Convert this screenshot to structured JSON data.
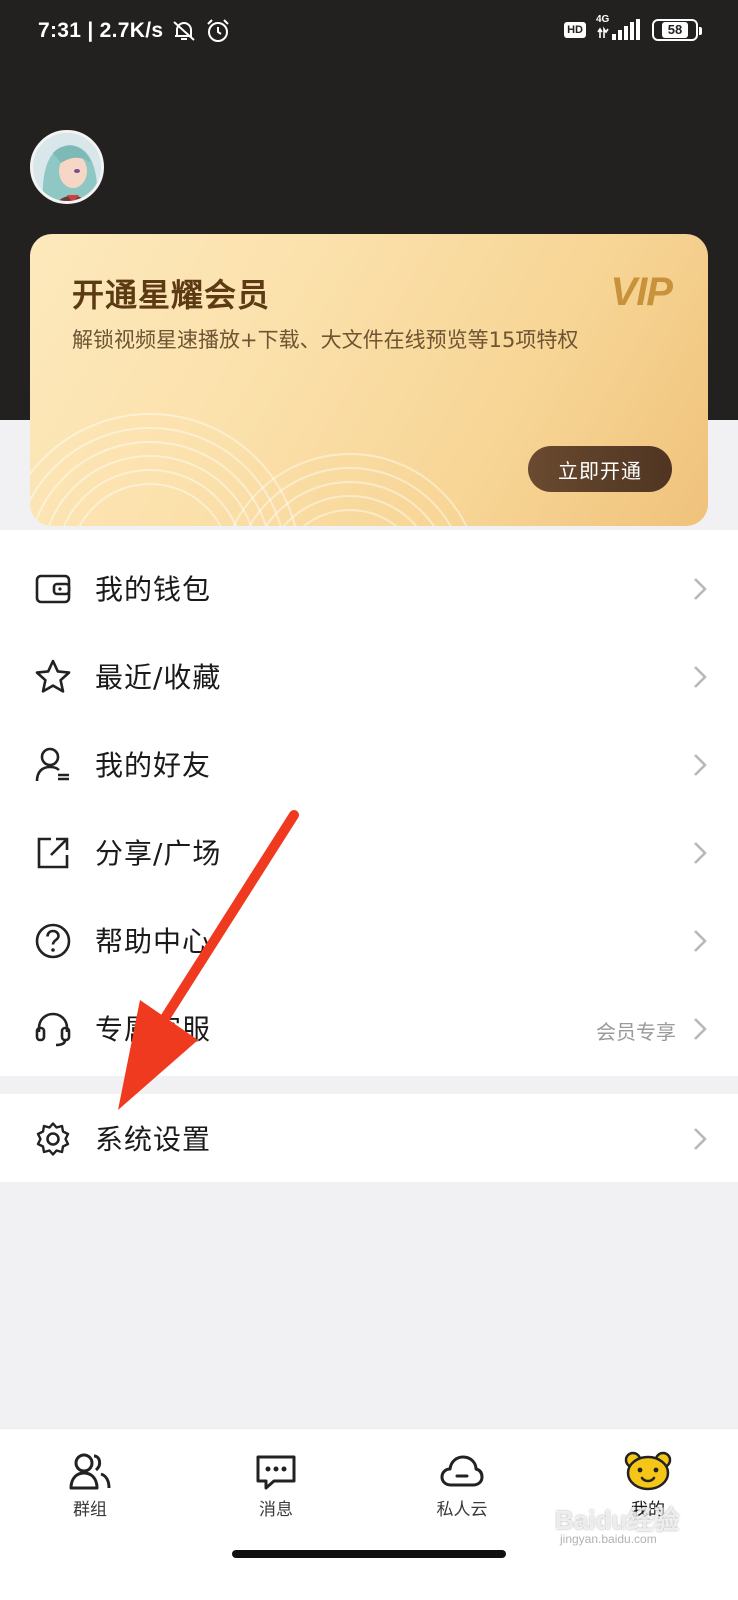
{
  "status_bar": {
    "time_and_speed": "7:31 | 2.7K/s",
    "hd_badge": "HD",
    "network": "4G",
    "battery": "58"
  },
  "vip": {
    "title": "开通星耀会员",
    "logo": "VIP",
    "description": "解锁视频星速播放+下载、大文件在线预览等15项特权",
    "button": "立即开通"
  },
  "menu": {
    "items": [
      {
        "label": "我的钱包",
        "icon": "wallet-icon"
      },
      {
        "label": "最近/收藏",
        "icon": "star-icon"
      },
      {
        "label": "我的好友",
        "icon": "friends-icon"
      },
      {
        "label": "分享/广场",
        "icon": "share-icon"
      },
      {
        "label": "帮助中心",
        "icon": "help-icon"
      },
      {
        "label": "专属客服",
        "icon": "headset-icon",
        "extra": "会员专享"
      }
    ],
    "settings": {
      "label": "系统设置",
      "icon": "gear-icon"
    }
  },
  "bottom_nav": {
    "items": [
      {
        "label": "群组",
        "icon": "group-icon"
      },
      {
        "label": "消息",
        "icon": "message-icon"
      },
      {
        "label": "私人云",
        "icon": "cloud-icon"
      },
      {
        "label": "我的",
        "icon": "bear-icon",
        "active": true
      }
    ]
  },
  "watermark": {
    "text": "Baidu经验",
    "sub": "jingyan.baidu.com"
  },
  "colors": {
    "header_bg": "#222120",
    "vip_gold": "#c8923a",
    "vip_text": "#5c3a14",
    "vip_button": "#4f3522",
    "annotation_arrow": "#f03a1f",
    "active_tab": "#f5c518"
  }
}
